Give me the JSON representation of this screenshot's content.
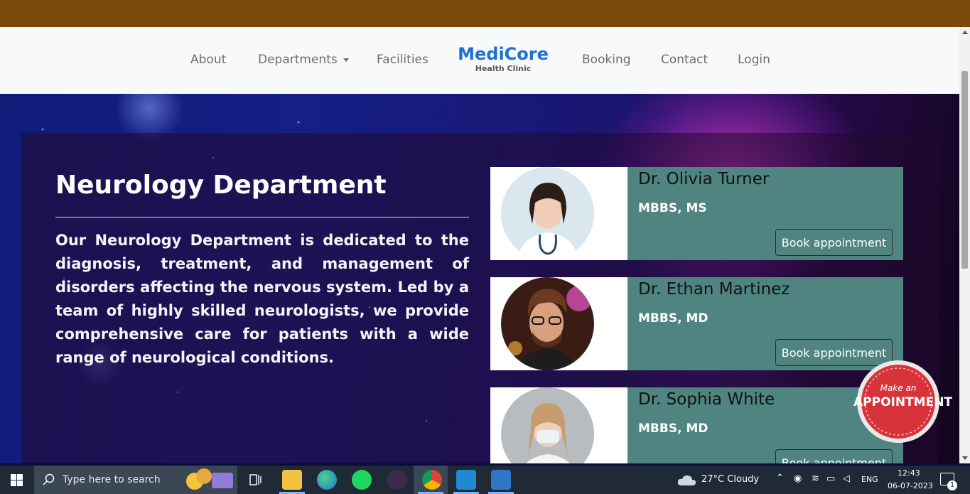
{
  "nav": {
    "items": [
      "About",
      "Departments",
      "Facilities",
      "Booking",
      "Contact",
      "Login"
    ],
    "brand_name": "MediCore",
    "brand_sub": "Health Clinic"
  },
  "department": {
    "title": "Neurology Department",
    "description": "Our Neurology Department is dedicated to the diagnosis, treatment, and management of disorders affecting the nervous system. Led by a team of highly skilled neurologists, we provide comprehensive care for patients with a wide range of neurological conditions."
  },
  "doctors": [
    {
      "name": "Dr. Olivia Turner",
      "degree": "MBBS, MS",
      "button": "Book appointment"
    },
    {
      "name": "Dr. Ethan Martinez",
      "degree": "MBBS, MD",
      "button": "Book appointment"
    },
    {
      "name": "Dr. Sophia White",
      "degree": "MBBS, MD",
      "button": "Book appointment"
    }
  ],
  "badge": {
    "line1": "Make an",
    "line2": "APPOINTMENT"
  },
  "colors": {
    "topbar": "#7a4a0d",
    "brand": "#1f6fd6",
    "card": "#4f8481",
    "badge": "#d8323a"
  },
  "taskbar": {
    "search_placeholder": "Type here to search",
    "weather": "27°C  Cloudy",
    "language": "ENG",
    "time": "12:43",
    "date": "06-07-2023",
    "notification_count": "1",
    "icons": [
      "windows-start-icon",
      "search-icon",
      "widgets-icon",
      "task-view-icon",
      "file-explorer-icon",
      "edge-icon",
      "spotify-icon",
      "app-icon",
      "chrome-icon",
      "vscode-icon",
      "photos-icon"
    ]
  }
}
